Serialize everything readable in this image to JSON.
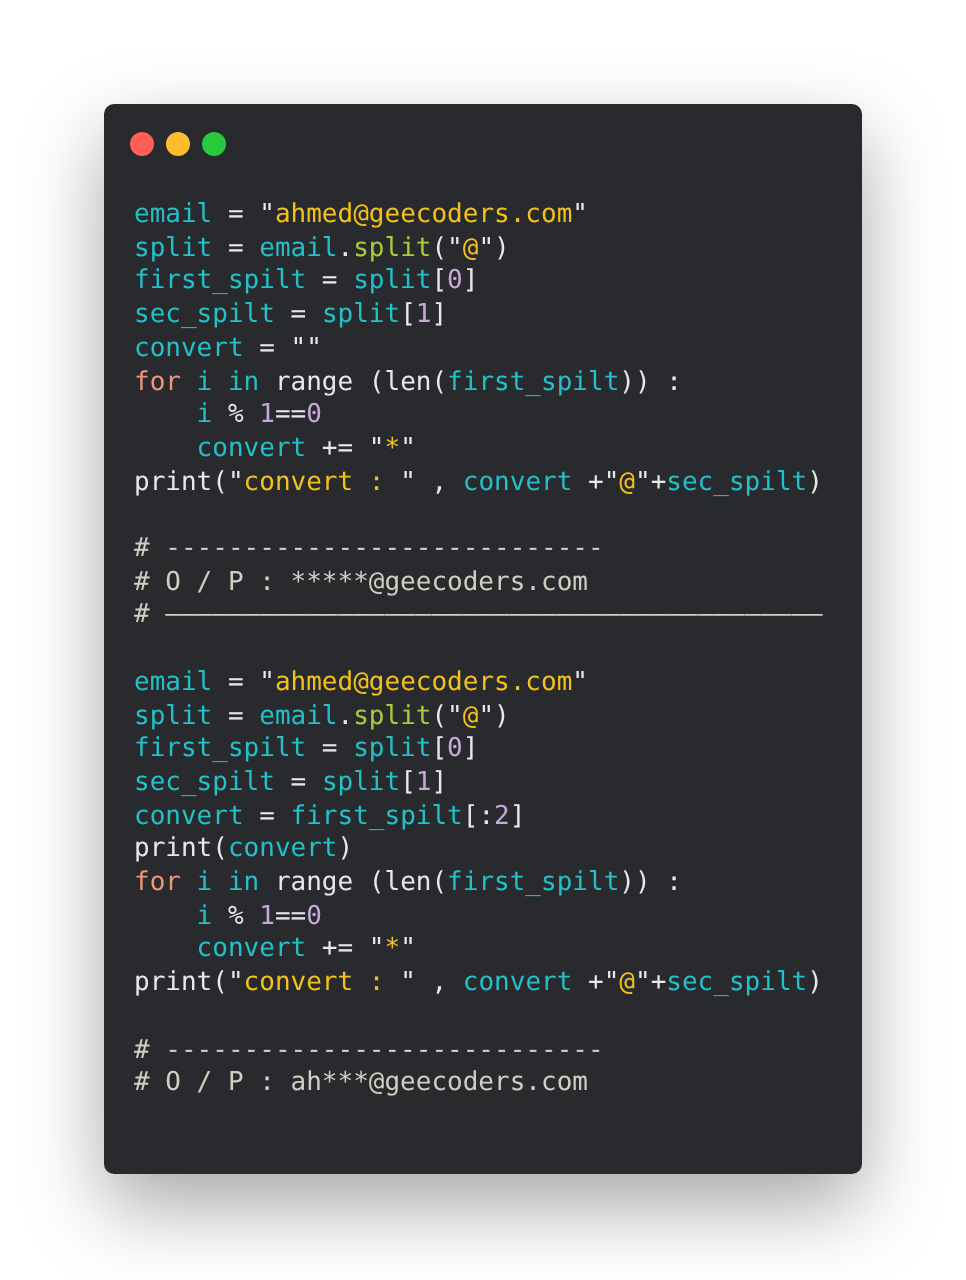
{
  "window": {
    "controls": [
      {
        "color": "#ff5f56"
      },
      {
        "color": "#ffbd2e"
      },
      {
        "color": "#27c93f"
      }
    ]
  },
  "code_blocks": [
    [
      [
        {
          "kind": "var",
          "text": "email"
        },
        {
          "kind": "plain",
          "text": " = \""
        },
        {
          "kind": "str",
          "text": "ahmed@geecoders.com"
        },
        {
          "kind": "plain",
          "text": "\""
        }
      ],
      [
        {
          "kind": "var",
          "text": "split"
        },
        {
          "kind": "plain",
          "text": " = "
        },
        {
          "kind": "var",
          "text": "email"
        },
        {
          "kind": "plain",
          "text": "."
        },
        {
          "kind": "fn",
          "text": "split"
        },
        {
          "kind": "plain",
          "text": "(\""
        },
        {
          "kind": "str",
          "text": "@"
        },
        {
          "kind": "plain",
          "text": "\")"
        }
      ],
      [
        {
          "kind": "var",
          "text": "first_spilt"
        },
        {
          "kind": "plain",
          "text": " = "
        },
        {
          "kind": "var",
          "text": "split"
        },
        {
          "kind": "plain",
          "text": "["
        },
        {
          "kind": "num",
          "text": "0"
        },
        {
          "kind": "plain",
          "text": "]"
        }
      ],
      [
        {
          "kind": "var",
          "text": "sec_spilt"
        },
        {
          "kind": "plain",
          "text": " = "
        },
        {
          "kind": "var",
          "text": "split"
        },
        {
          "kind": "plain",
          "text": "["
        },
        {
          "kind": "num",
          "text": "1"
        },
        {
          "kind": "plain",
          "text": "]"
        }
      ],
      [
        {
          "kind": "var",
          "text": "convert"
        },
        {
          "kind": "plain",
          "text": " = \"\""
        }
      ],
      [
        {
          "kind": "kw",
          "text": "for"
        },
        {
          "kind": "var",
          "text": " i"
        },
        {
          "kind": "var",
          "text": " in"
        },
        {
          "kind": "plain",
          "text": " range (len("
        },
        {
          "kind": "var",
          "text": "first_spilt"
        },
        {
          "kind": "plain",
          "text": ")) :"
        }
      ],
      [
        {
          "kind": "var",
          "text": "    i"
        },
        {
          "kind": "plain",
          "text": " % "
        },
        {
          "kind": "num",
          "text": "1"
        },
        {
          "kind": "plain",
          "text": "=="
        },
        {
          "kind": "num",
          "text": "0"
        }
      ],
      [
        {
          "kind": "var",
          "text": "    convert"
        },
        {
          "kind": "plain",
          "text": " += \""
        },
        {
          "kind": "str",
          "text": "*"
        },
        {
          "kind": "plain",
          "text": "\""
        }
      ],
      [
        {
          "kind": "plain",
          "text": "print(\""
        },
        {
          "kind": "str",
          "text": "convert : "
        },
        {
          "kind": "plain",
          "text": "\" , "
        },
        {
          "kind": "var",
          "text": "convert"
        },
        {
          "kind": "plain",
          "text": " +\""
        },
        {
          "kind": "str",
          "text": "@"
        },
        {
          "kind": "plain",
          "text": "\"+"
        },
        {
          "kind": "var",
          "text": "sec_spilt"
        },
        {
          "kind": "plain",
          "text": ")"
        }
      ]
    ],
    [
      [
        {
          "kind": "comment",
          "text": "# ----------------------------"
        }
      ],
      [
        {
          "kind": "comment",
          "text": "# O / P : *****@geecoders.com"
        }
      ],
      [
        {
          "kind": "comment",
          "text": "# ——————————————————————————————————————————"
        }
      ]
    ],
    [
      [
        {
          "kind": "var",
          "text": "email"
        },
        {
          "kind": "plain",
          "text": " = \""
        },
        {
          "kind": "str",
          "text": "ahmed@geecoders.com"
        },
        {
          "kind": "plain",
          "text": "\""
        }
      ],
      [
        {
          "kind": "var",
          "text": "split"
        },
        {
          "kind": "plain",
          "text": " = "
        },
        {
          "kind": "var",
          "text": "email"
        },
        {
          "kind": "plain",
          "text": "."
        },
        {
          "kind": "fn",
          "text": "split"
        },
        {
          "kind": "plain",
          "text": "(\""
        },
        {
          "kind": "str",
          "text": "@"
        },
        {
          "kind": "plain",
          "text": "\")"
        }
      ],
      [
        {
          "kind": "var",
          "text": "first_spilt"
        },
        {
          "kind": "plain",
          "text": " = "
        },
        {
          "kind": "var",
          "text": "split"
        },
        {
          "kind": "plain",
          "text": "["
        },
        {
          "kind": "num",
          "text": "0"
        },
        {
          "kind": "plain",
          "text": "]"
        }
      ],
      [
        {
          "kind": "var",
          "text": "sec_spilt"
        },
        {
          "kind": "plain",
          "text": " = "
        },
        {
          "kind": "var",
          "text": "split"
        },
        {
          "kind": "plain",
          "text": "["
        },
        {
          "kind": "num",
          "text": "1"
        },
        {
          "kind": "plain",
          "text": "]"
        }
      ],
      [
        {
          "kind": "var",
          "text": "convert"
        },
        {
          "kind": "plain",
          "text": " = "
        },
        {
          "kind": "var",
          "text": "first_spilt"
        },
        {
          "kind": "plain",
          "text": "[:"
        },
        {
          "kind": "num",
          "text": "2"
        },
        {
          "kind": "plain",
          "text": "]"
        }
      ],
      [
        {
          "kind": "plain",
          "text": "print("
        },
        {
          "kind": "var",
          "text": "convert"
        },
        {
          "kind": "plain",
          "text": ")"
        }
      ],
      [
        {
          "kind": "kw",
          "text": "for"
        },
        {
          "kind": "var",
          "text": " i"
        },
        {
          "kind": "var",
          "text": " in"
        },
        {
          "kind": "plain",
          "text": " range (len("
        },
        {
          "kind": "var",
          "text": "first_spilt"
        },
        {
          "kind": "plain",
          "text": ")) :"
        }
      ],
      [
        {
          "kind": "var",
          "text": "    i"
        },
        {
          "kind": "plain",
          "text": " % "
        },
        {
          "kind": "num",
          "text": "1"
        },
        {
          "kind": "plain",
          "text": "=="
        },
        {
          "kind": "num",
          "text": "0"
        }
      ],
      [
        {
          "kind": "var",
          "text": "    convert"
        },
        {
          "kind": "plain",
          "text": " += \""
        },
        {
          "kind": "str",
          "text": "*"
        },
        {
          "kind": "plain",
          "text": "\""
        }
      ],
      [
        {
          "kind": "plain",
          "text": "print(\""
        },
        {
          "kind": "str",
          "text": "convert : "
        },
        {
          "kind": "plain",
          "text": "\" , "
        },
        {
          "kind": "var",
          "text": "convert"
        },
        {
          "kind": "plain",
          "text": " +\""
        },
        {
          "kind": "str",
          "text": "@"
        },
        {
          "kind": "plain",
          "text": "\"+"
        },
        {
          "kind": "var",
          "text": "sec_spilt"
        },
        {
          "kind": "plain",
          "text": ")"
        }
      ]
    ],
    [
      [
        {
          "kind": "comment",
          "text": "# ----------------------------"
        }
      ],
      [
        {
          "kind": "comment",
          "text": "# O / P : ah***@geecoders.com"
        }
      ]
    ]
  ]
}
